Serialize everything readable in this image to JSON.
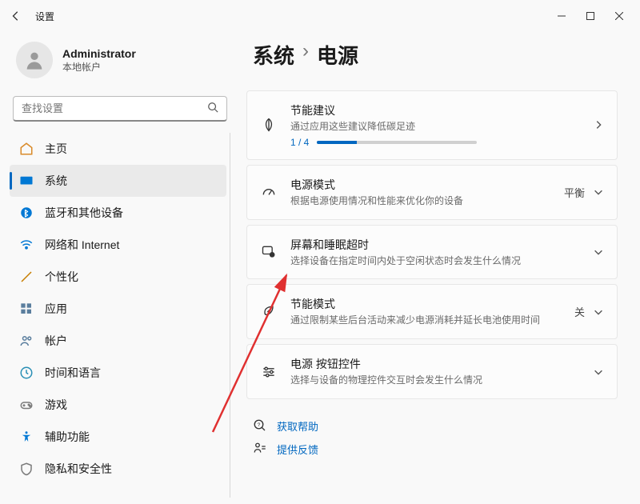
{
  "titlebar": {
    "title": "设置"
  },
  "user": {
    "name": "Administrator",
    "type": "本地帐户"
  },
  "search": {
    "placeholder": "查找设置"
  },
  "nav": {
    "items": [
      {
        "label": "主页"
      },
      {
        "label": "系统"
      },
      {
        "label": "蓝牙和其他设备"
      },
      {
        "label": "网络和 Internet"
      },
      {
        "label": "个性化"
      },
      {
        "label": "应用"
      },
      {
        "label": "帐户"
      },
      {
        "label": "时间和语言"
      },
      {
        "label": "游戏"
      },
      {
        "label": "辅助功能"
      },
      {
        "label": "隐私和安全性"
      }
    ],
    "selected_index": 1
  },
  "breadcrumb": {
    "parent": "系统",
    "sep": "›",
    "current": "电源"
  },
  "cards": {
    "energy": {
      "title": "节能建议",
      "sub": "通过应用这些建议降低碳足迹",
      "progress_label": "1 / 4",
      "progress_pct": 25
    },
    "power_mode": {
      "title": "电源模式",
      "sub": "根据电源使用情况和性能来优化你的设备",
      "value": "平衡"
    },
    "screen_sleep": {
      "title": "屏幕和睡眠超时",
      "sub": "选择设备在指定时间内处于空闲状态时会发生什么情况"
    },
    "battery_saver": {
      "title": "节能模式",
      "sub": "通过限制某些后台活动来减少电源消耗并延长电池使用时间",
      "value": "关"
    },
    "button_controls": {
      "title": "电源 按钮控件",
      "sub": "选择与设备的物理控件交互时会发生什么情况"
    }
  },
  "footer": {
    "help": "获取帮助",
    "feedback": "提供反馈"
  },
  "annotation": {
    "arrow_color": "#E03030"
  }
}
